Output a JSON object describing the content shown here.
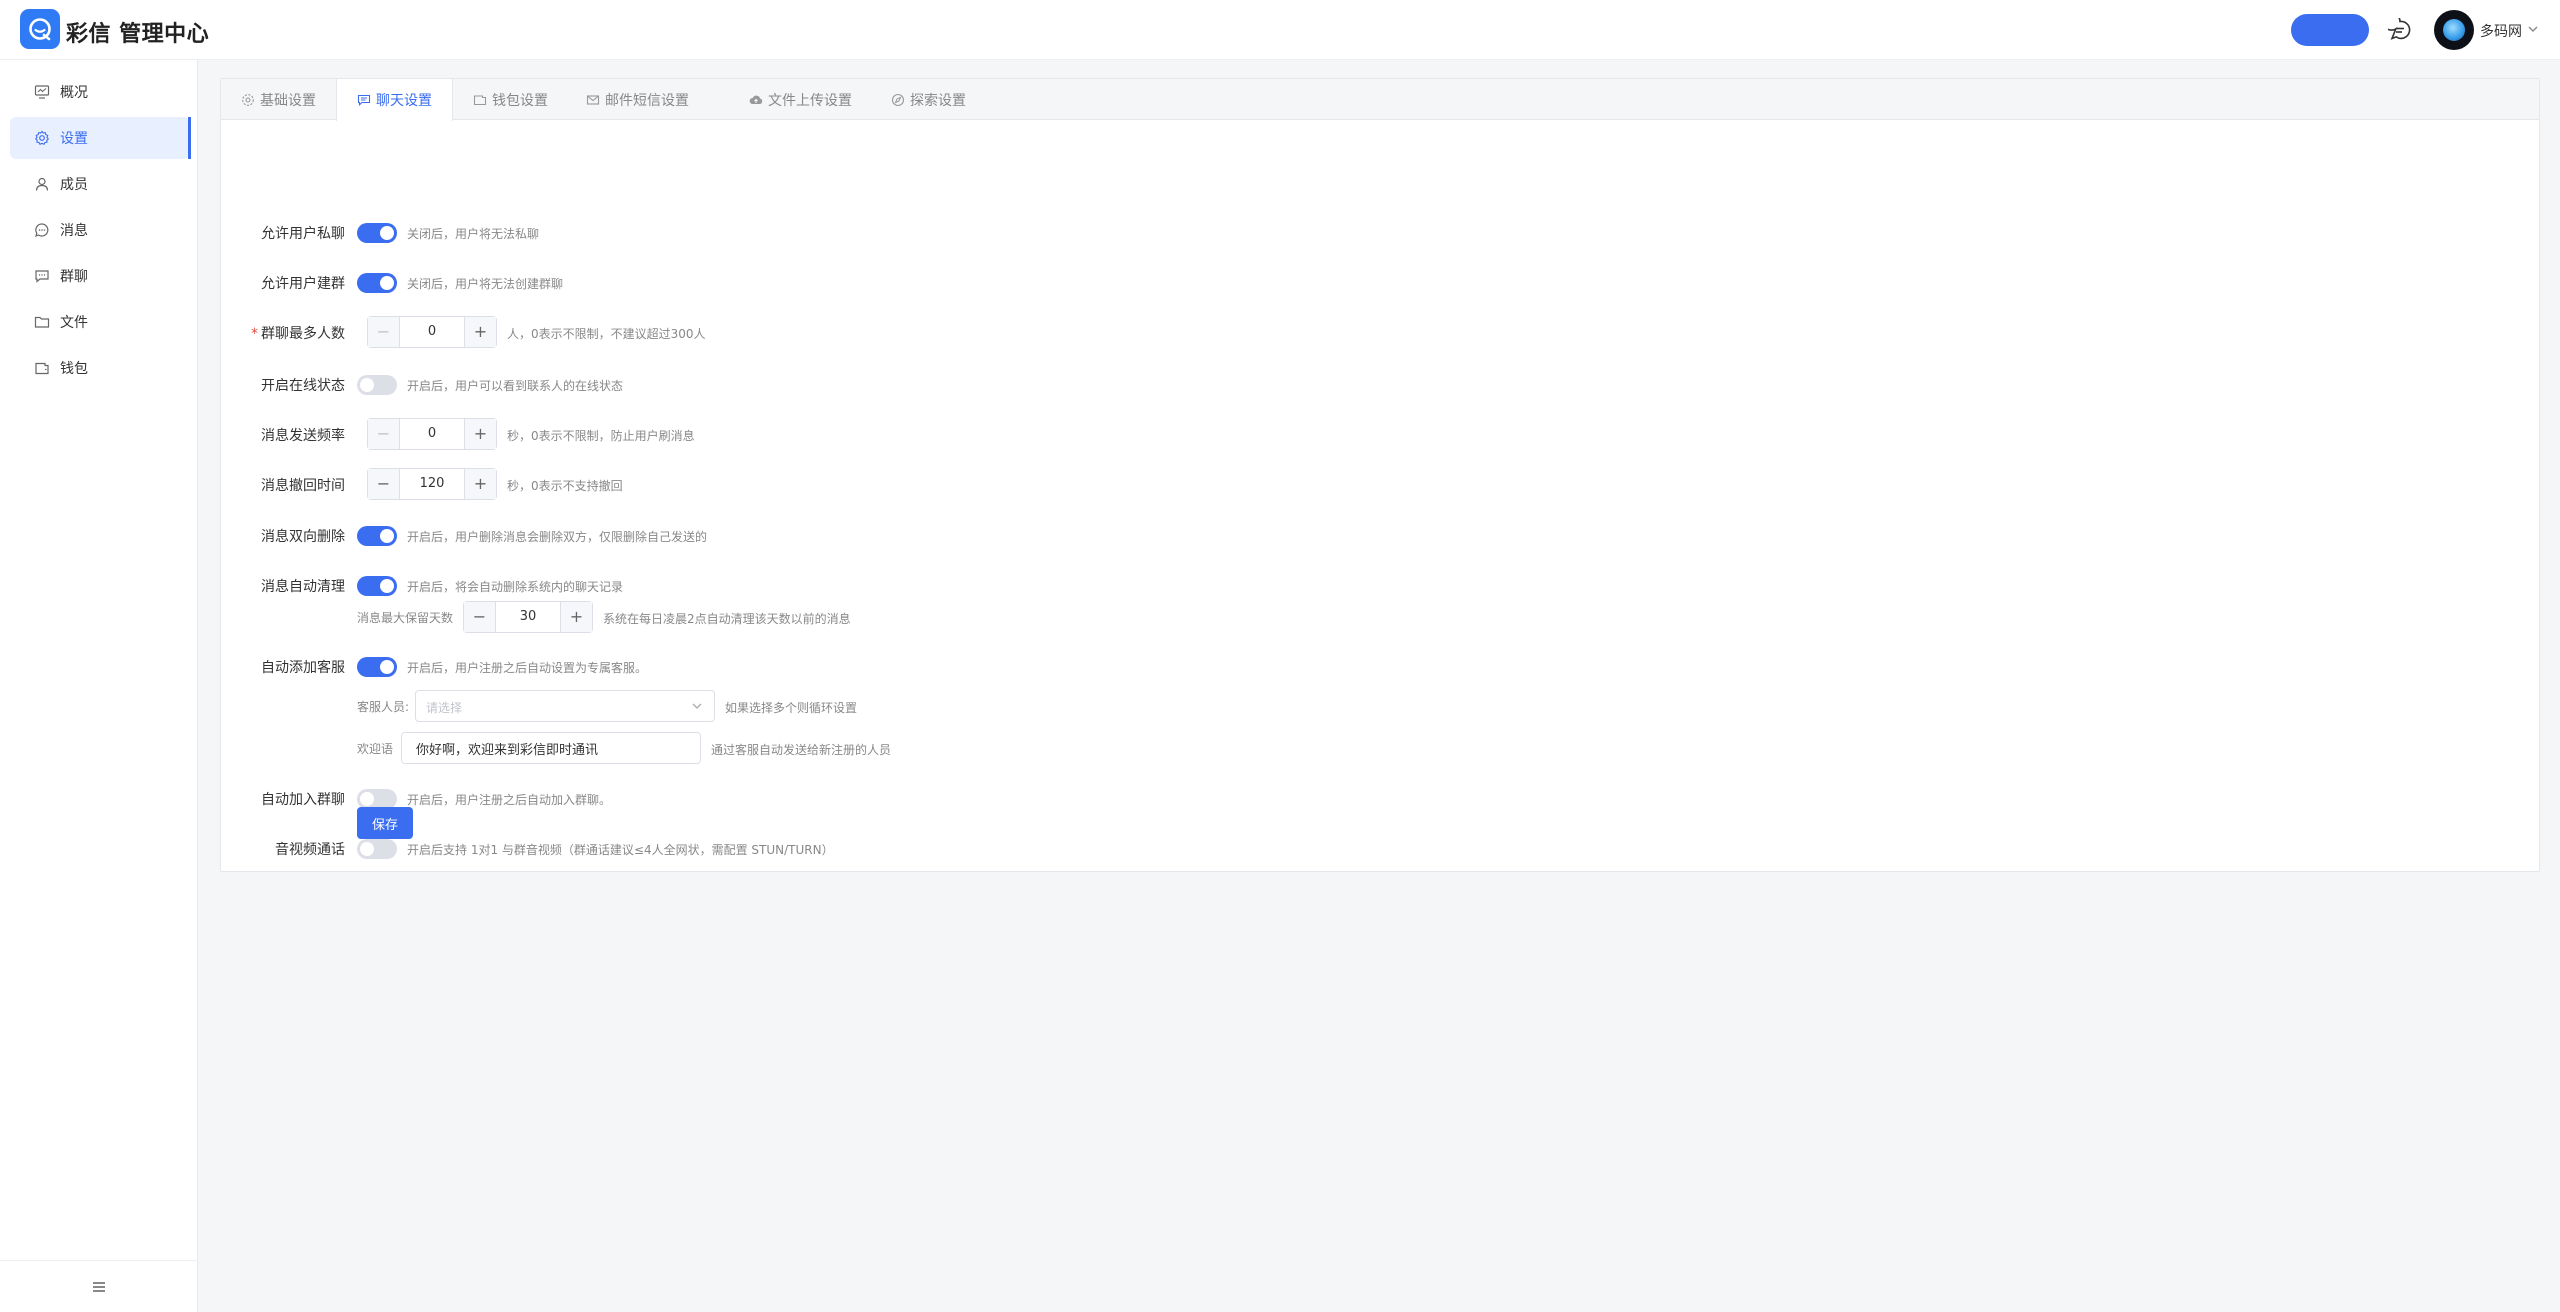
{
  "app": {
    "title": "彩信 管理中心",
    "username": "多码网"
  },
  "sidebar": {
    "items": [
      {
        "label": "概况",
        "icon": "monitor-icon"
      },
      {
        "label": "设置",
        "icon": "gear-icon"
      },
      {
        "label": "成员",
        "icon": "user-icon"
      },
      {
        "label": "消息",
        "icon": "chat-icon"
      },
      {
        "label": "群聊",
        "icon": "group-chat-icon"
      },
      {
        "label": "文件",
        "icon": "folder-icon"
      },
      {
        "label": "钱包",
        "icon": "wallet-icon"
      }
    ],
    "active": "设置"
  },
  "tabs": [
    {
      "label": "基础设置",
      "icon": "gear-icon"
    },
    {
      "label": "聊天设置",
      "icon": "chat-icon"
    },
    {
      "label": "钱包设置",
      "icon": "wallet-icon"
    },
    {
      "label": "邮件短信设置",
      "icon": "mail-icon"
    },
    {
      "label": "文件上传设置",
      "icon": "cloud-upload-icon"
    },
    {
      "label": "探索设置",
      "icon": "compass-icon"
    }
  ],
  "active_tab": "聊天设置",
  "form": {
    "private_chat": {
      "label": "允许用户私聊",
      "on": true,
      "hint": "关闭后，用户将无法私聊"
    },
    "create_group": {
      "label": "允许用户建群",
      "on": true,
      "hint": "关闭后，用户将无法创建群聊"
    },
    "group_max": {
      "label": "群聊最多人数",
      "required": "*",
      "value": "0",
      "hint": "人，0表示不限制，不建议超过300人"
    },
    "online_status": {
      "label": "开启在线状态",
      "on": false,
      "hint": "开启后，用户可以看到联系人的在线状态"
    },
    "send_rate": {
      "label": "消息发送频率",
      "value": "0",
      "hint": "秒，0表示不限制，防止用户刷消息"
    },
    "recall_time": {
      "label": "消息撤回时间",
      "value": "120",
      "hint": "秒，0表示不支持撤回"
    },
    "two_way_delete": {
      "label": "消息双向删除",
      "on": true,
      "hint": "开启后，用户删除消息会删除双方，仅限删除自己发送的"
    },
    "auto_clean": {
      "label": "消息自动清理",
      "on": true,
      "hint": "开启后，将会自动删除系统内的聊天记录",
      "days_label": "消息最大保留天数",
      "days_value": "30",
      "days_hint": "系统在每日凌晨2点自动清理该天数以前的消息"
    },
    "auto_service": {
      "label": "自动添加客服",
      "on": true,
      "hint": "开启后，用户注册之后自动设置为专属客服。",
      "staff_label": "客服人员:",
      "staff_placeholder": "请选择",
      "staff_hint": "如果选择多个则循环设置",
      "greeting_label": "欢迎语",
      "greeting_value": "你好啊，欢迎来到彩信即时通讯",
      "greeting_hint": "通过客服自动发送给新注册的人员"
    },
    "auto_join_group": {
      "label": "自动加入群聊",
      "on": false,
      "hint": "开启后，用户注册之后自动加入群聊。"
    },
    "av_call": {
      "label": "音视频通话",
      "on": false,
      "hint": "开启后支持 1对1 与群音视频（群通话建议≤4人全网状，需配置 STUN/TURN）"
    },
    "save_label": "保存"
  },
  "colors": {
    "accent": "#3a6df0",
    "logo": "#2f7bf5",
    "required": "#e54d42"
  }
}
